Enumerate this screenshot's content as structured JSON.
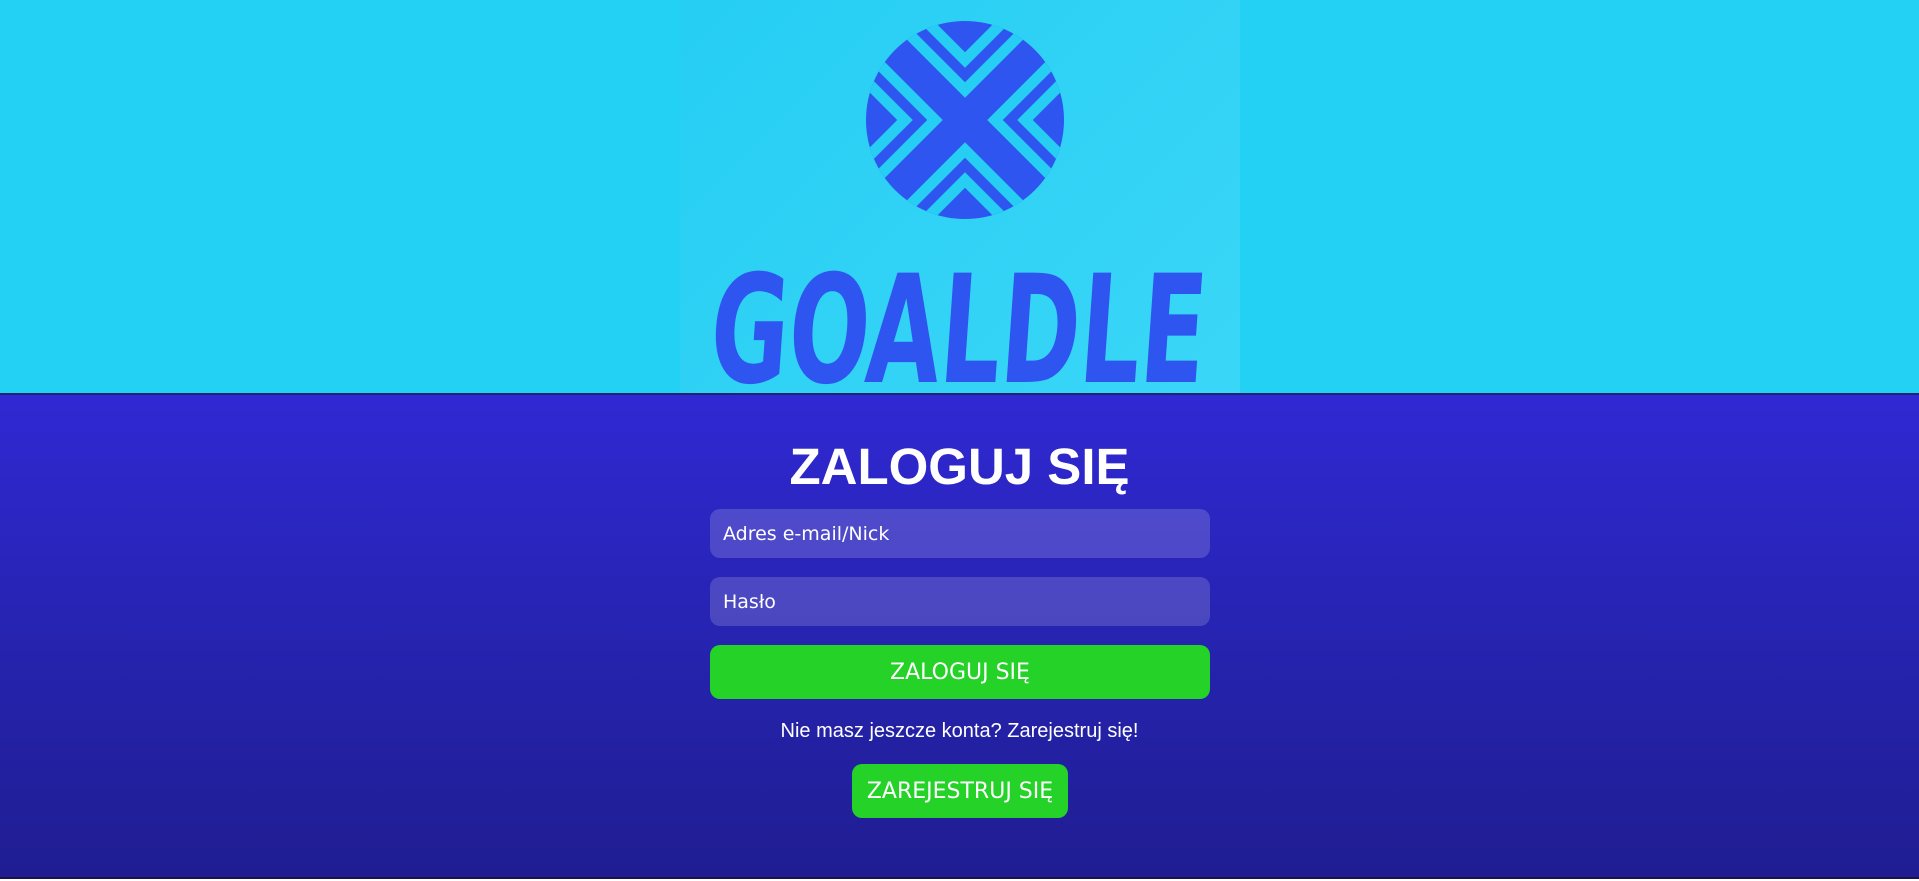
{
  "logo": {
    "icon": "crossed-chevrons-circle-icon",
    "wordmark": "GOALDLE"
  },
  "login": {
    "title": "ZALOGUJ SIĘ",
    "email_placeholder": "Adres e-mail/Nick",
    "password_placeholder": "Hasło",
    "submit_label": "ZALOGUJ SIĘ"
  },
  "register": {
    "hint": "Nie masz jeszcze konta? Zarejestruj się!",
    "button_label": "ZAREJESTRUJ SIĘ"
  },
  "colors": {
    "header_bg": "#23d1f5",
    "logo_blue": "#2f55f0",
    "main_bg": "#2523ad",
    "button_green": "#25d228",
    "text": "#ffffff"
  }
}
